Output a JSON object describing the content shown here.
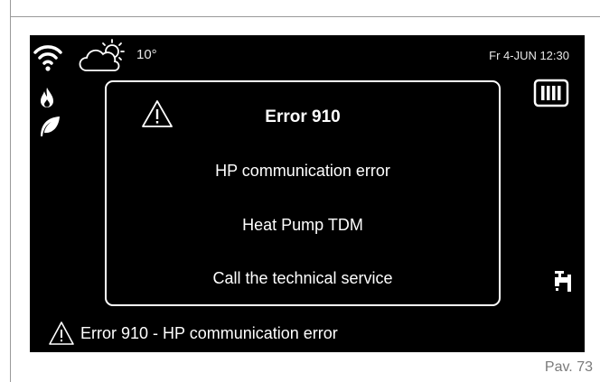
{
  "header": {
    "temperature": "10°",
    "datetime": "Fr 4-JUN 12:30"
  },
  "icons": {
    "wifi": "wifi-icon",
    "weather": "partly-cloudy-icon",
    "flame": "flame-icon",
    "leaf": "leaf-icon",
    "radiator": "radiator-icon",
    "tap": "tap-icon",
    "warning": "warning-triangle-icon"
  },
  "error_dialog": {
    "title": "Error 910",
    "line1": "HP communication error",
    "line2": "Heat Pump TDM",
    "line3": "Call the technical service"
  },
  "status_bar": {
    "message": "Error 910 - HP communication error"
  },
  "page": {
    "number": "Pav. 73"
  },
  "colors": {
    "screen_bg": "#000000",
    "text": "#ffffff"
  }
}
